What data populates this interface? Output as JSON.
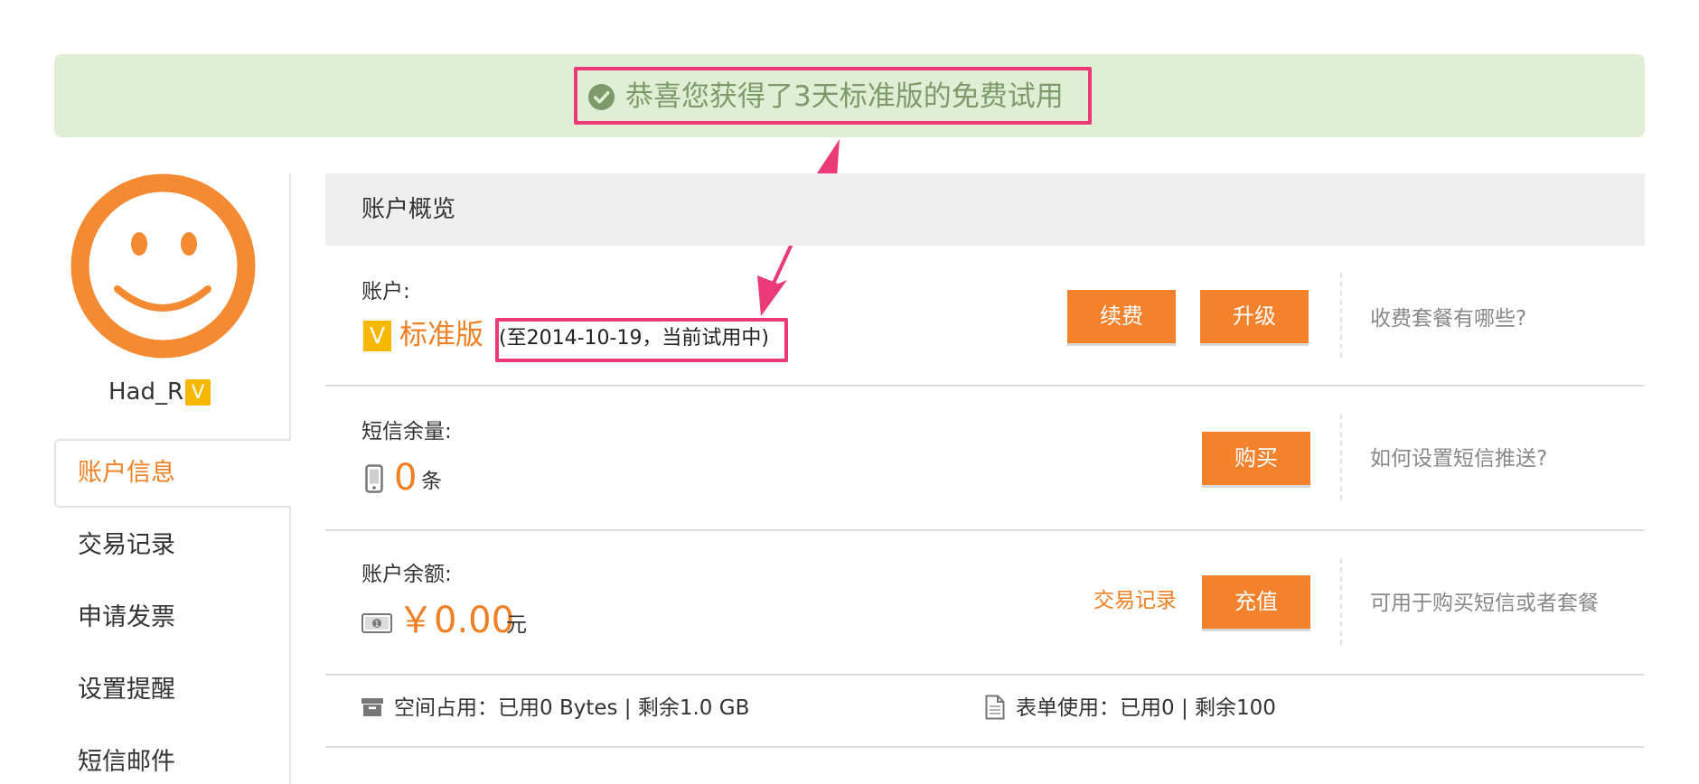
{
  "banner": {
    "message": "恭喜您获得了3天标准版的免费试用",
    "icon": "check-circle-icon",
    "color": "#7d9a6a",
    "background": "#e1eed6"
  },
  "annotation": {
    "color": "#ea3a77"
  },
  "sidebar": {
    "username": "Had_R",
    "vip_badge": "V",
    "nav": [
      {
        "label": "账户信息",
        "active": true
      },
      {
        "label": "交易记录",
        "active": false
      },
      {
        "label": "申请发票",
        "active": false
      },
      {
        "label": "设置提醒",
        "active": false
      },
      {
        "label": "短信邮件",
        "active": false
      }
    ]
  },
  "main": {
    "title": "账户概览",
    "account": {
      "label": "账户:",
      "badge": "V",
      "plan": "标准版",
      "expiry": "(至2014-10-19，当前试用中)",
      "renew_button": "续费",
      "upgrade_button": "升级",
      "help": "收费套餐有哪些?"
    },
    "sms": {
      "label": "短信余量:",
      "count": "0",
      "unit": "条",
      "buy_button": "购买",
      "help": "如何设置短信推送?"
    },
    "balance": {
      "label": "账户余额:",
      "amount": "￥0.00",
      "unit": "元",
      "history_link": "交易记录",
      "recharge_button": "充值",
      "help": "可用于购买短信或者套餐"
    },
    "storage": {
      "text": "空间占用：已用0 Bytes | 剩余1.0 GB"
    },
    "forms": {
      "text": "表单使用：已用0 | 剩余100"
    }
  },
  "colors": {
    "accent": "#f08023",
    "button": "#f4812b",
    "vip": "#f6b800"
  }
}
